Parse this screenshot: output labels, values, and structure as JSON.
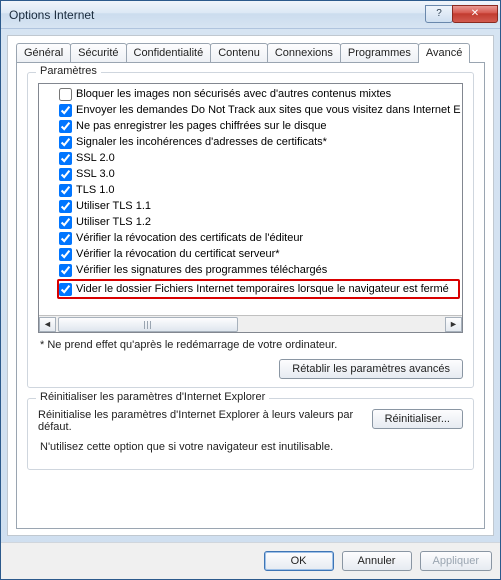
{
  "window": {
    "title": "Options Internet"
  },
  "tabs": {
    "general": "Général",
    "security": "Sécurité",
    "privacy": "Confidentialité",
    "content": "Contenu",
    "connections": "Connexions",
    "programs": "Programmes",
    "advanced": "Avancé"
  },
  "params_group": "Paramètres",
  "settings": [
    {
      "checked": false,
      "label": "Bloquer les images non sécurisés avec d'autres contenus mixtes"
    },
    {
      "checked": true,
      "label": "Envoyer les demandes Do Not Track aux sites que vous visitez dans Internet E"
    },
    {
      "checked": true,
      "label": "Ne pas enregistrer les pages chiffrées sur le disque"
    },
    {
      "checked": true,
      "label": "Signaler les incohérences d'adresses de certificats*"
    },
    {
      "checked": true,
      "label": "SSL 2.0"
    },
    {
      "checked": true,
      "label": "SSL 3.0"
    },
    {
      "checked": true,
      "label": "TLS 1.0"
    },
    {
      "checked": true,
      "label": "Utiliser TLS 1.1"
    },
    {
      "checked": true,
      "label": "Utiliser TLS 1.2"
    },
    {
      "checked": true,
      "label": "Vérifier la révocation des certificats de l'éditeur"
    },
    {
      "checked": true,
      "label": "Vérifier la révocation du certificat serveur*"
    },
    {
      "checked": true,
      "label": "Vérifier les signatures des programmes téléchargés"
    },
    {
      "checked": true,
      "label": "Vider le dossier Fichiers Internet temporaires lorsque le navigateur est fermé",
      "highlight": true
    }
  ],
  "restart_note": "* Ne prend effet qu'après le redémarrage de votre ordinateur.",
  "restore_btn": "Rétablir les paramètres avancés",
  "reset_group": "Réinitialiser les paramètres d'Internet Explorer",
  "reset_desc": "Réinitialise les paramètres d'Internet Explorer à leurs valeurs par défaut.",
  "reset_btn": "Réinitialiser...",
  "reset_warn": "N'utilisez cette option que si votre navigateur est inutilisable.",
  "buttons": {
    "ok": "OK",
    "cancel": "Annuler",
    "apply": "Appliquer"
  }
}
